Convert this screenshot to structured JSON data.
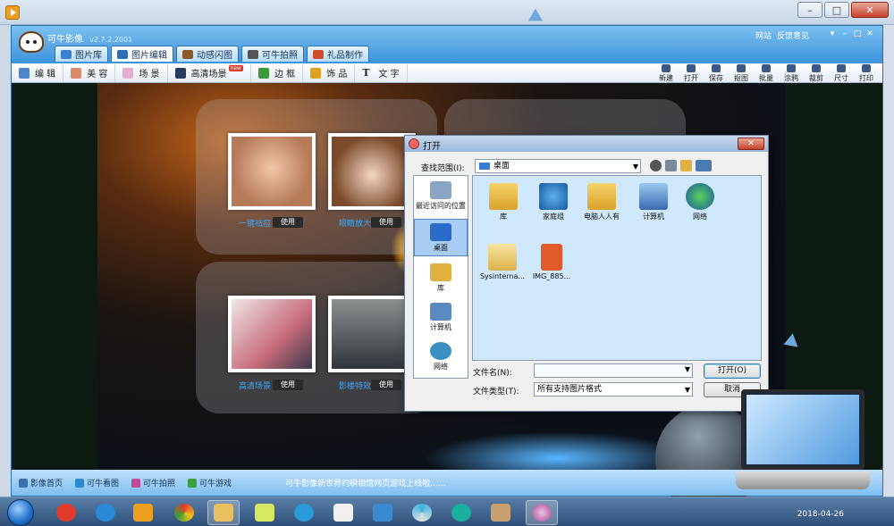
{
  "app": {
    "title": "可牛影像",
    "version": "v2.7.2.2001",
    "header_links": [
      "网站",
      "反馈意见"
    ],
    "tabs": [
      {
        "label": "图片库",
        "icon": "picture-library-icon",
        "active": false
      },
      {
        "label": "图片编辑",
        "icon": "image-edit-icon",
        "active": true
      },
      {
        "label": "动感闪图",
        "icon": "flash-gif-icon",
        "active": false
      },
      {
        "label": "可牛拍照",
        "icon": "camera-icon",
        "active": false
      },
      {
        "label": "礼品制作",
        "icon": "gift-icon",
        "active": false
      }
    ],
    "toolbar_left": [
      {
        "label": "编 辑",
        "icon": "edit-icon"
      },
      {
        "label": "美 容",
        "icon": "beauty-icon"
      },
      {
        "label": "场 景",
        "icon": "scene-icon"
      },
      {
        "label": "高清场景",
        "icon": "hd-scene-icon",
        "badge": "new"
      },
      {
        "label": "边 框",
        "icon": "frame-icon"
      },
      {
        "label": "饰 品",
        "icon": "accessory-icon"
      },
      {
        "label": "文 字",
        "icon": "text-icon"
      }
    ],
    "toolbar_right": [
      {
        "label": "新建",
        "icon": "new-icon"
      },
      {
        "label": "打开",
        "icon": "open-icon"
      },
      {
        "label": "保存",
        "icon": "save-icon"
      },
      {
        "label": "抠图",
        "icon": "cutout-icon"
      },
      {
        "label": "批量",
        "icon": "batch-icon"
      },
      {
        "label": "涂鸦",
        "icon": "doodle-icon"
      },
      {
        "label": "裁剪",
        "icon": "crop-icon"
      },
      {
        "label": "尺寸",
        "icon": "resize-icon"
      },
      {
        "label": "打印",
        "icon": "print-icon"
      }
    ],
    "gallery": [
      {
        "label": "一键祛痘",
        "use": "使用"
      },
      {
        "label": "眼睛放大",
        "use": "使用"
      },
      {
        "label": "高清场景",
        "use": "使用"
      },
      {
        "label": "影楼特效",
        "use": "使用"
      }
    ],
    "status_links": [
      {
        "label": "影像首页",
        "icon": "home-icon"
      },
      {
        "label": "可牛看图",
        "icon": "viewer-icon"
      },
      {
        "label": "可牛拍照",
        "icon": "camera-icon"
      },
      {
        "label": "可牛游戏",
        "icon": "game-icon"
      }
    ],
    "status_message": "可牛影像新世界约瞬相馆网页游戏上线啦……"
  },
  "dialog": {
    "title": "打开",
    "close_label": "✕",
    "lookin_label": "查找范围(I):",
    "lookin_value": "桌面",
    "places": [
      {
        "label": "最近访问的位置",
        "icon": "recent-places-icon",
        "active": false
      },
      {
        "label": "桌面",
        "icon": "desktop-icon",
        "active": true
      },
      {
        "label": "库",
        "icon": "library-icon",
        "active": false
      },
      {
        "label": "计算机",
        "icon": "computer-icon",
        "active": false
      },
      {
        "label": "网络",
        "icon": "network-icon",
        "active": false
      }
    ],
    "files": [
      {
        "label": "库",
        "icon": "library-folder-icon"
      },
      {
        "label": "家庭组",
        "icon": "homegroup-icon"
      },
      {
        "label": "电脑人人有",
        "icon": "user-folder-icon"
      },
      {
        "label": "计算机",
        "icon": "computer-icon"
      },
      {
        "label": "网络",
        "icon": "network-icon"
      },
      {
        "label": "Sysinterna...",
        "icon": "folder-icon"
      },
      {
        "label": "IMG_885...",
        "icon": "image-file-icon"
      }
    ],
    "filename_label": "文件名(N):",
    "filename_value": "",
    "filetype_label": "文件类型(T):",
    "filetype_value": "所有支持图片格式",
    "open_button": "打开(O)",
    "cancel_button": "取消"
  },
  "taskbar": {
    "date": "2018-04-26",
    "icons": [
      "start-orb-icon",
      "app-red-icon",
      "ie-icon",
      "media-player-icon",
      "chrome-icon",
      "explorer-icon",
      "notes-icon",
      "search-app-icon",
      "word-icon",
      "remote-icon",
      "pinwheel-icon",
      "headset-icon",
      "paint-icon",
      "keniu-icon"
    ]
  },
  "colors": {
    "app_blue": "#3a8fd8",
    "link_blue": "#38a8ff",
    "stage_dark": "#0c1a11"
  }
}
